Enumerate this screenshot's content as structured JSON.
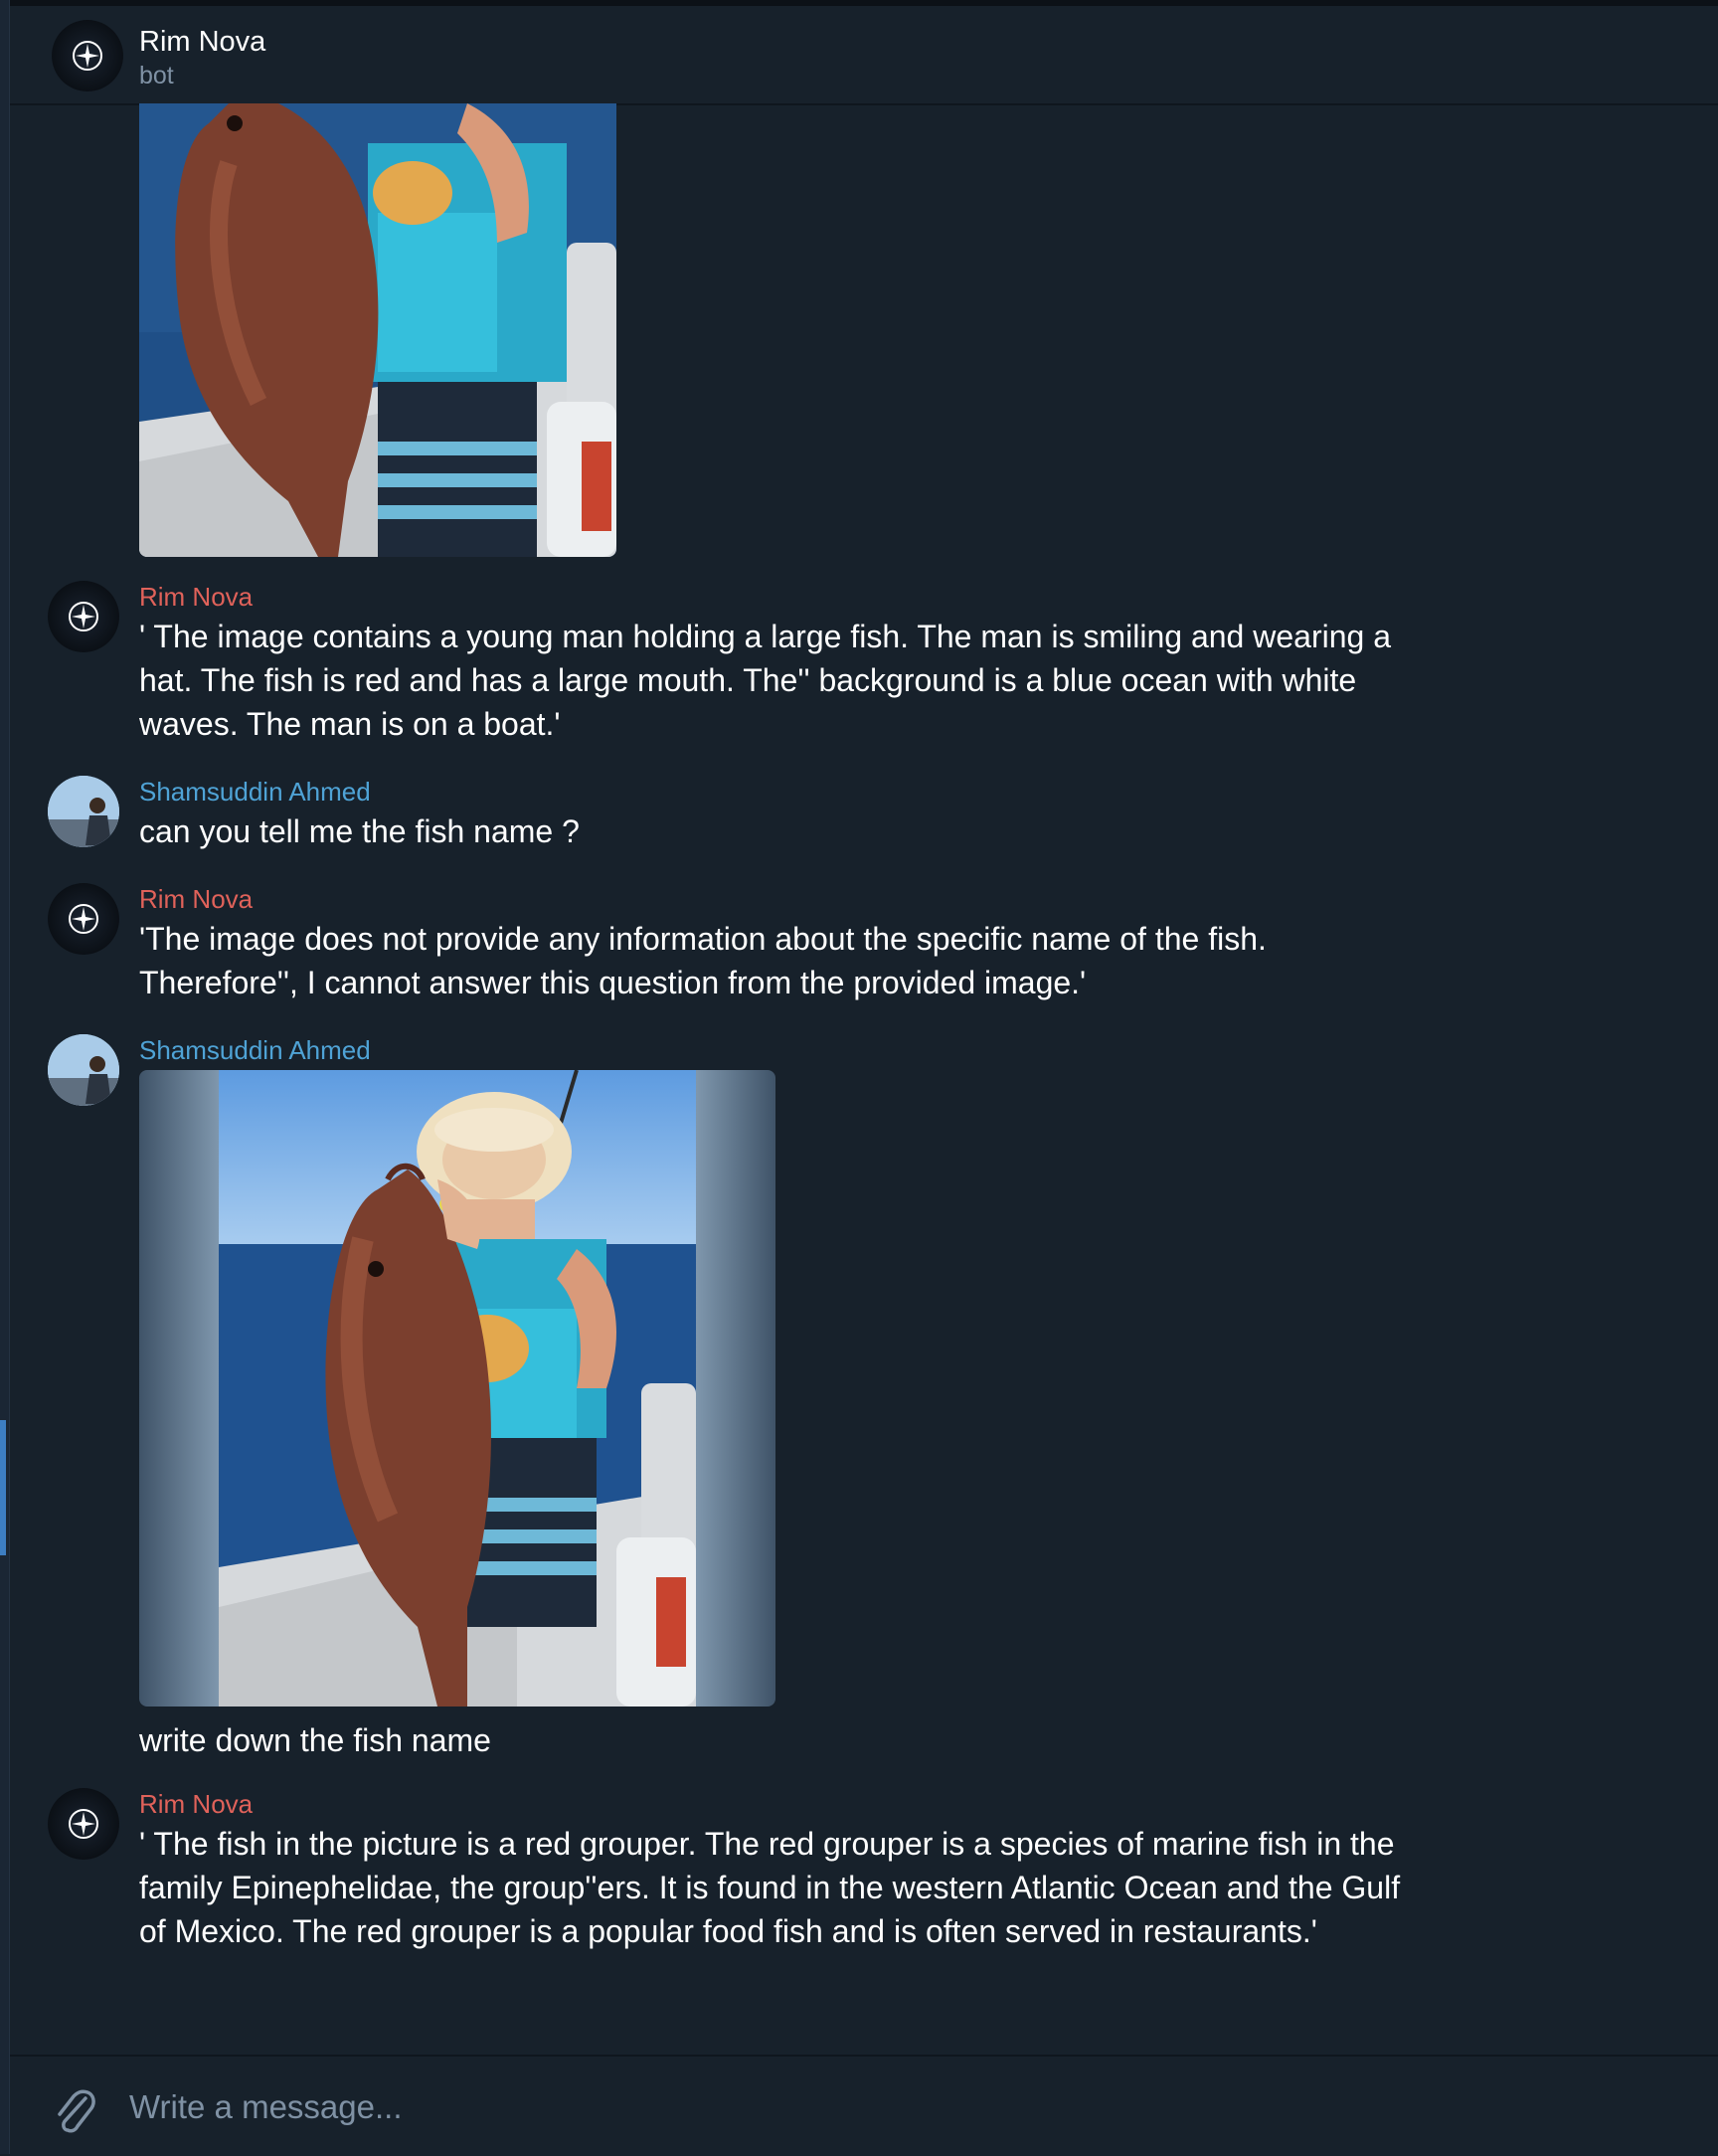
{
  "header": {
    "title": "Rim Nova",
    "subtitle": "bot"
  },
  "messages": [
    {
      "sender": "Rim Nova",
      "text": "' The image contains a young man holding a large fish. The man is smiling and wearing a hat. The fish is red and has a large mouth. The'' background is a blue ocean with white waves. The man is on a boat.'"
    },
    {
      "sender": "Shamsuddin Ahmed",
      "text": "can you tell me the fish name ?"
    },
    {
      "sender": "Rim Nova",
      "text": "'The image does not provide any information about the specific name of the fish. Therefore'', I cannot answer this question from the provided image.'"
    },
    {
      "sender": "Shamsuddin Ahmed",
      "caption": "write down the fish name"
    },
    {
      "sender": "Rim Nova",
      "text": "' The fish in the picture is a red grouper. The red grouper is a species of marine fish in the family Epinephelidae, the group''ers. It is found in the western Atlantic Ocean and the Gulf of Mexico. The red grouper is a popular food fish and is often served in restaurants.'"
    }
  ],
  "composer": {
    "placeholder": "Write a message..."
  },
  "colors": {
    "background": "#17212b",
    "bot_name": "#e0625a",
    "user_name": "#4fa3d6",
    "muted": "#7f91a4"
  },
  "icons": [
    "bot-compass-icon",
    "user-photo-avatar",
    "paperclip-icon"
  ]
}
